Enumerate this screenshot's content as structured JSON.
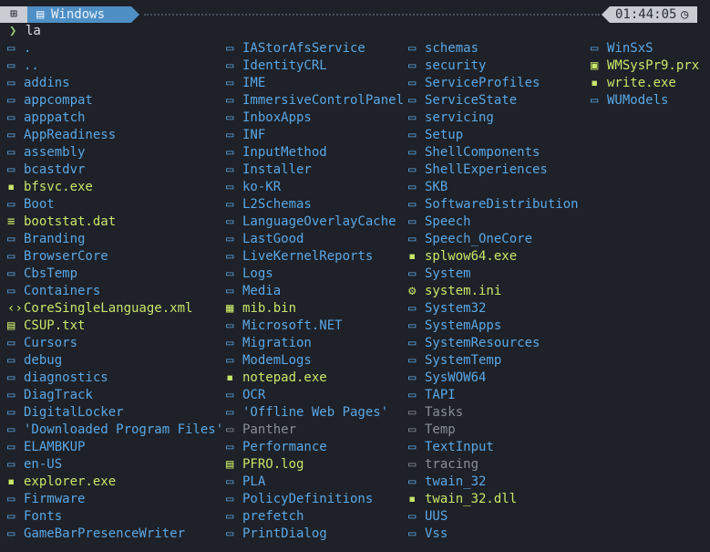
{
  "prompt": {
    "os_icon": "windows-logo-icon",
    "directory": "Windows",
    "time": "01:44:05",
    "clock_icon": "clock-icon",
    "chevron": "❯",
    "command": "la"
  },
  "colors": {
    "background": "#1e2127",
    "directory": "#5aa7e6",
    "file": "#c8e66a",
    "hidden": "#8b8f97",
    "prompt_segment": "#4e8fc5"
  },
  "columns": [
    [
      {
        "name": ".",
        "kind": "dir",
        "icon": "folder-icon"
      },
      {
        "name": "..",
        "kind": "dir",
        "icon": "folder-icon"
      },
      {
        "name": "addins",
        "kind": "dir",
        "icon": "folder-icon"
      },
      {
        "name": "appcompat",
        "kind": "dir",
        "icon": "folder-icon"
      },
      {
        "name": "apppatch",
        "kind": "dir",
        "icon": "folder-icon"
      },
      {
        "name": "AppReadiness",
        "kind": "dir",
        "icon": "folder-icon"
      },
      {
        "name": "assembly",
        "kind": "dir",
        "icon": "folder-icon"
      },
      {
        "name": "bcastdvr",
        "kind": "dir",
        "icon": "folder-icon"
      },
      {
        "name": "bfsvc.exe",
        "kind": "exe",
        "icon": "executable-icon"
      },
      {
        "name": "Boot",
        "kind": "dir",
        "icon": "folder-icon"
      },
      {
        "name": "bootstat.dat",
        "kind": "dat",
        "icon": "database-icon"
      },
      {
        "name": "Branding",
        "kind": "dir",
        "icon": "folder-icon"
      },
      {
        "name": "BrowserCore",
        "kind": "dir",
        "icon": "folder-icon"
      },
      {
        "name": "CbsTemp",
        "kind": "dir",
        "icon": "folder-icon"
      },
      {
        "name": "Containers",
        "kind": "dir",
        "icon": "folder-icon"
      },
      {
        "name": "CoreSingleLanguage.xml",
        "kind": "xml",
        "icon": "code-icon"
      },
      {
        "name": "CSUP.txt",
        "kind": "txtf",
        "icon": "text-file-icon"
      },
      {
        "name": "Cursors",
        "kind": "dir",
        "icon": "folder-icon"
      },
      {
        "name": "debug",
        "kind": "dir",
        "icon": "folder-icon"
      },
      {
        "name": "diagnostics",
        "kind": "dir",
        "icon": "folder-icon"
      },
      {
        "name": "DiagTrack",
        "kind": "dir",
        "icon": "folder-icon"
      },
      {
        "name": "DigitalLocker",
        "kind": "dir",
        "icon": "folder-icon"
      },
      {
        "name": "'Downloaded Program Files'",
        "kind": "dir",
        "icon": "folder-icon"
      },
      {
        "name": "ELAMBKUP",
        "kind": "dir",
        "icon": "folder-icon"
      },
      {
        "name": "en-US",
        "kind": "dir",
        "icon": "folder-icon"
      },
      {
        "name": "explorer.exe",
        "kind": "exe",
        "icon": "executable-icon"
      },
      {
        "name": "Firmware",
        "kind": "dir",
        "icon": "folder-icon"
      },
      {
        "name": "Fonts",
        "kind": "dir",
        "icon": "folder-icon"
      },
      {
        "name": "GameBarPresenceWriter",
        "kind": "dir",
        "icon": "folder-icon"
      }
    ],
    [
      {
        "name": "IAStorAfsService",
        "kind": "dir",
        "icon": "folder-icon"
      },
      {
        "name": "IdentityCRL",
        "kind": "dir",
        "icon": "folder-icon"
      },
      {
        "name": "IME",
        "kind": "dir",
        "icon": "folder-icon"
      },
      {
        "name": "ImmersiveControlPanel",
        "kind": "dir",
        "icon": "folder-icon"
      },
      {
        "name": "InboxApps",
        "kind": "dir",
        "icon": "folder-icon"
      },
      {
        "name": "INF",
        "kind": "dir",
        "icon": "folder-icon"
      },
      {
        "name": "InputMethod",
        "kind": "dir",
        "icon": "folder-icon"
      },
      {
        "name": "Installer",
        "kind": "dir",
        "icon": "folder-icon"
      },
      {
        "name": "ko-KR",
        "kind": "dir",
        "icon": "folder-icon"
      },
      {
        "name": "L2Schemas",
        "kind": "dir",
        "icon": "folder-icon"
      },
      {
        "name": "LanguageOverlayCache",
        "kind": "dir",
        "icon": "folder-icon"
      },
      {
        "name": "LastGood",
        "kind": "dir",
        "icon": "folder-icon"
      },
      {
        "name": "LiveKernelReports",
        "kind": "dir",
        "icon": "folder-icon"
      },
      {
        "name": "Logs",
        "kind": "dir",
        "icon": "folder-icon"
      },
      {
        "name": "Media",
        "kind": "dir",
        "icon": "folder-icon"
      },
      {
        "name": "mib.bin",
        "kind": "dat",
        "icon": "binary-icon"
      },
      {
        "name": "Microsoft.NET",
        "kind": "dir",
        "icon": "folder-icon"
      },
      {
        "name": "Migration",
        "kind": "dir",
        "icon": "folder-icon"
      },
      {
        "name": "ModemLogs",
        "kind": "dir",
        "icon": "folder-icon"
      },
      {
        "name": "notepad.exe",
        "kind": "exe",
        "icon": "executable-icon"
      },
      {
        "name": "OCR",
        "kind": "dir",
        "icon": "folder-icon"
      },
      {
        "name": "'Offline Web Pages'",
        "kind": "dir",
        "icon": "folder-icon"
      },
      {
        "name": "Panther",
        "kind": "dim",
        "icon": "folder-icon"
      },
      {
        "name": "Performance",
        "kind": "dir",
        "icon": "folder-icon"
      },
      {
        "name": "PFRO.log",
        "kind": "log",
        "icon": "log-file-icon"
      },
      {
        "name": "PLA",
        "kind": "dir",
        "icon": "folder-icon"
      },
      {
        "name": "PolicyDefinitions",
        "kind": "dir",
        "icon": "folder-icon"
      },
      {
        "name": "prefetch",
        "kind": "dir",
        "icon": "folder-icon"
      },
      {
        "name": "PrintDialog",
        "kind": "dir",
        "icon": "folder-icon"
      }
    ],
    [
      {
        "name": "schemas",
        "kind": "dir",
        "icon": "folder-icon"
      },
      {
        "name": "security",
        "kind": "dir",
        "icon": "folder-icon"
      },
      {
        "name": "ServiceProfiles",
        "kind": "dir",
        "icon": "folder-icon"
      },
      {
        "name": "ServiceState",
        "kind": "dir",
        "icon": "folder-icon"
      },
      {
        "name": "servicing",
        "kind": "dir",
        "icon": "folder-icon"
      },
      {
        "name": "Setup",
        "kind": "dir",
        "icon": "folder-icon"
      },
      {
        "name": "ShellComponents",
        "kind": "dir",
        "icon": "folder-icon"
      },
      {
        "name": "ShellExperiences",
        "kind": "dir",
        "icon": "folder-icon"
      },
      {
        "name": "SKB",
        "kind": "dir",
        "icon": "folder-icon"
      },
      {
        "name": "SoftwareDistribution",
        "kind": "dir",
        "icon": "folder-icon"
      },
      {
        "name": "Speech",
        "kind": "dir",
        "icon": "folder-icon"
      },
      {
        "name": "Speech_OneCore",
        "kind": "dir",
        "icon": "folder-icon"
      },
      {
        "name": "splwow64.exe",
        "kind": "exe",
        "icon": "executable-icon"
      },
      {
        "name": "System",
        "kind": "dir",
        "icon": "folder-icon"
      },
      {
        "name": "system.ini",
        "kind": "ini",
        "icon": "gear-icon"
      },
      {
        "name": "System32",
        "kind": "dir",
        "icon": "folder-icon"
      },
      {
        "name": "SystemApps",
        "kind": "dir",
        "icon": "folder-icon"
      },
      {
        "name": "SystemResources",
        "kind": "dir",
        "icon": "folder-icon"
      },
      {
        "name": "SystemTemp",
        "kind": "dir",
        "icon": "folder-icon"
      },
      {
        "name": "SysWOW64",
        "kind": "dir",
        "icon": "folder-icon"
      },
      {
        "name": "TAPI",
        "kind": "dir",
        "icon": "folder-icon"
      },
      {
        "name": "Tasks",
        "kind": "dim",
        "icon": "folder-icon"
      },
      {
        "name": "Temp",
        "kind": "dim",
        "icon": "folder-icon"
      },
      {
        "name": "TextInput",
        "kind": "dir",
        "icon": "folder-icon"
      },
      {
        "name": "tracing",
        "kind": "dim",
        "icon": "folder-icon"
      },
      {
        "name": "twain_32",
        "kind": "dir",
        "icon": "folder-icon"
      },
      {
        "name": "twain_32.dll",
        "kind": "dll",
        "icon": "library-icon"
      },
      {
        "name": "UUS",
        "kind": "dir",
        "icon": "folder-icon"
      },
      {
        "name": "Vss",
        "kind": "dir",
        "icon": "folder-icon"
      }
    ],
    [
      {
        "name": "WinSxS",
        "kind": "dir",
        "icon": "folder-icon"
      },
      {
        "name": "WMSysPr9.prx",
        "kind": "prx",
        "icon": "terminal-file-icon"
      },
      {
        "name": "write.exe",
        "kind": "exe",
        "icon": "executable-icon"
      },
      {
        "name": "WUModels",
        "kind": "dir",
        "icon": "folder-icon"
      }
    ]
  ]
}
